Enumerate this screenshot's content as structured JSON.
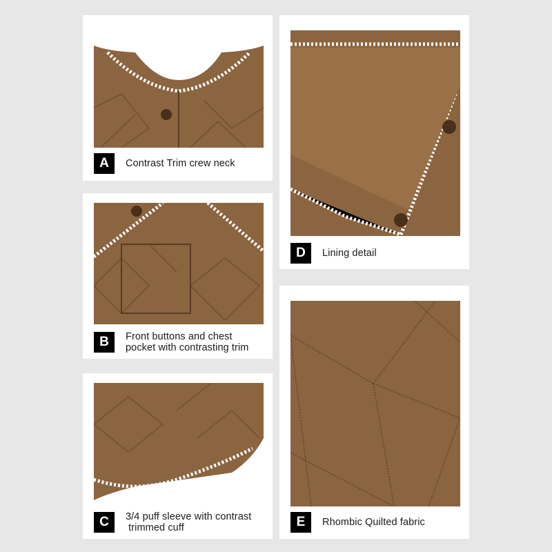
{
  "colors": {
    "fabric": "#8b6440",
    "fabric_dark": "#6e4c2e",
    "stitch": "#5a3c22",
    "trim": "#ffffff",
    "badge": "#000000",
    "background": "#e7e7e7"
  },
  "panels": {
    "a": {
      "letter": "A",
      "caption_lines": [
        "Contrast Trim crew neck"
      ]
    },
    "b": {
      "letter": "B",
      "caption_lines": [
        "Front buttons and chest",
        "pocket with contrasting trim"
      ]
    },
    "c": {
      "letter": "C",
      "caption_lines": [
        "3/4 puff sleeve with contrast",
        " trimmed cuff"
      ]
    },
    "d": {
      "letter": "D",
      "caption_lines": [
        "Lining detail"
      ]
    },
    "e": {
      "letter": "E",
      "caption_lines": [
        "Rhombic Quilted fabric"
      ]
    }
  }
}
